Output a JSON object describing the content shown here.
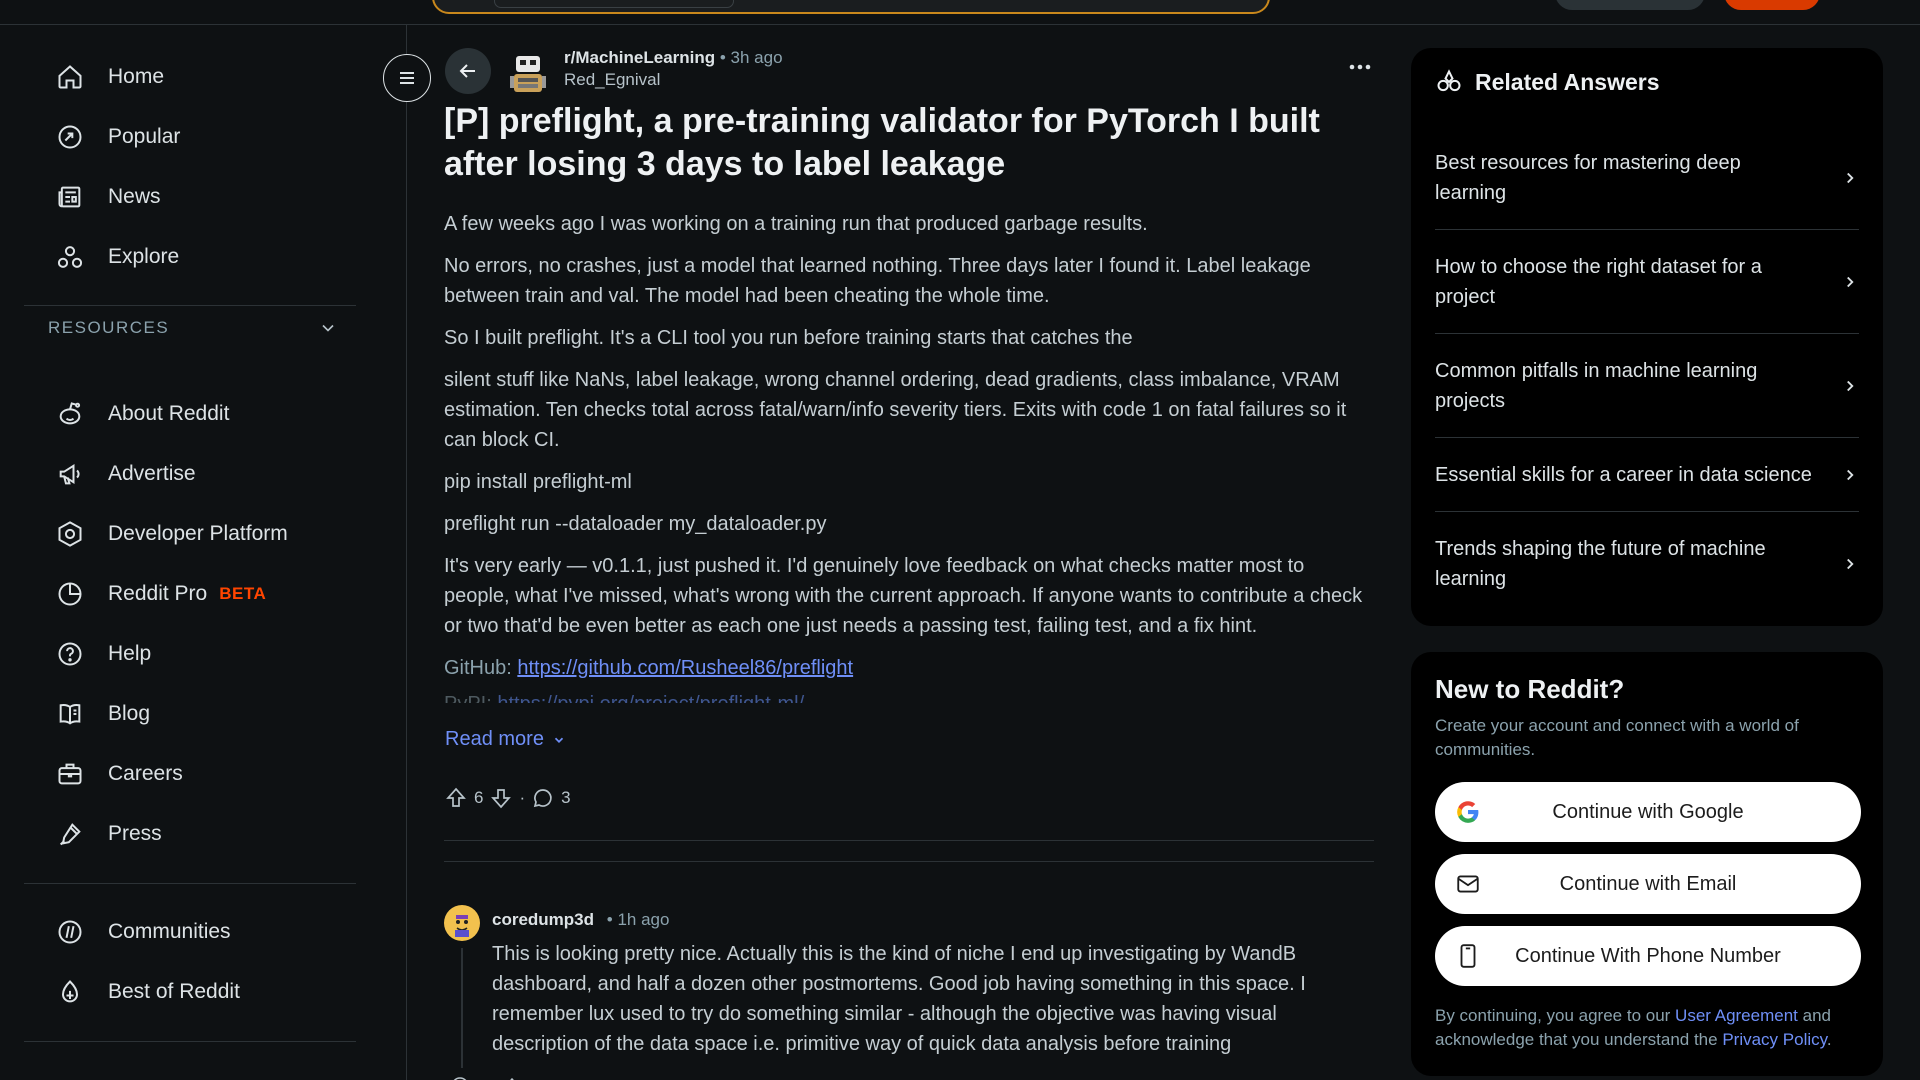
{
  "sidebar": {
    "items": [
      {
        "label": "Home",
        "icon": "home-icon"
      },
      {
        "label": "Popular",
        "icon": "popular-icon"
      },
      {
        "label": "News",
        "icon": "news-icon"
      },
      {
        "label": "Explore",
        "icon": "explore-icon"
      }
    ],
    "resources_heading": "RESOURCES",
    "resources": [
      {
        "label": "About Reddit",
        "icon": "reddit-icon"
      },
      {
        "label": "Advertise",
        "icon": "megaphone-icon"
      },
      {
        "label": "Developer Platform",
        "icon": "developer-icon"
      },
      {
        "label": "Reddit Pro",
        "icon": "pie-chart-icon",
        "badge": "BETA"
      },
      {
        "label": "Help",
        "icon": "help-icon"
      },
      {
        "label": "Blog",
        "icon": "book-icon"
      },
      {
        "label": "Careers",
        "icon": "briefcase-icon"
      },
      {
        "label": "Press",
        "icon": "pen-icon"
      }
    ],
    "bottom": [
      {
        "label": "Communities",
        "icon": "communities-icon"
      },
      {
        "label": "Best of Reddit",
        "icon": "best-of-icon"
      }
    ]
  },
  "post": {
    "subreddit": "r/MachineLearning",
    "time": "• 3h ago",
    "author": "Red_Egnival",
    "title": "[P] preflight, a pre-training validator for PyTorch I built after losing 3 days to label leakage",
    "paragraphs": [
      "A few weeks ago I was working on a training run that produced garbage results.",
      "No errors, no crashes, just a model that learned nothing. Three days later I found it. Label leakage between train and val. The model had been cheating the whole time.",
      "So I built preflight. It's a CLI tool you run before training starts that catches the",
      "silent stuff like NaNs, label leakage, wrong channel ordering, dead gradients, class imbalance, VRAM estimation. Ten checks total across fatal/warn/info severity tiers. Exits with code 1 on fatal failures so it can block CI.",
      "pip install preflight-ml",
      "preflight run --dataloader my_dataloader.py",
      "It's very early — v0.1.1, just pushed it. I'd genuinely love feedback on what checks matter most to people, what I've missed, what's wrong with the current approach. If anyone wants to contribute a check or two that'd be even better as each one just needs a passing test, failing test, and a fix hint."
    ],
    "github_label": "GitHub: ",
    "github_url": "https://github.com/Rusheel86/preflight",
    "pypi_label": "PyPI: ",
    "pypi_url": "https://pypi.org/project/preflight-ml/",
    "read_more": "Read more",
    "upvotes": "6",
    "separator": "·",
    "comments": "3"
  },
  "comment": {
    "author": "coredump3d",
    "time": "• 1h ago",
    "body": "This is looking pretty nice. Actually this is the kind of niche I end up investigating by WandB dashboard, and half a dozen other postmortems. Good job having something in this space. I remember lux used to try do something similar - although the objective was having visual description of the data space i.e. primitive way of quick data analysis before training"
  },
  "related": {
    "heading": "Related Answers",
    "items": [
      "Best resources for mastering deep learning",
      "How to choose the right dataset for a project",
      "Common pitfalls in machine learning projects",
      "Essential skills for a career in data science",
      "Trends shaping the future of machine learning"
    ]
  },
  "signup": {
    "title": "New to Reddit?",
    "description": "Create your account and connect with a world of communities.",
    "google": "Continue with Google",
    "email": "Continue with Email",
    "phone": "Continue With Phone Number",
    "legal_prefix": "By continuing, you agree to our ",
    "user_agreement": "User Agreement",
    "legal_middle": " and acknowledge that you understand the ",
    "privacy_policy": "Privacy Policy",
    "legal_suffix": "."
  },
  "colors": {
    "background": "#0e1113",
    "accent_orange": "#ff4500",
    "link_blue": "#6f8ff7"
  }
}
